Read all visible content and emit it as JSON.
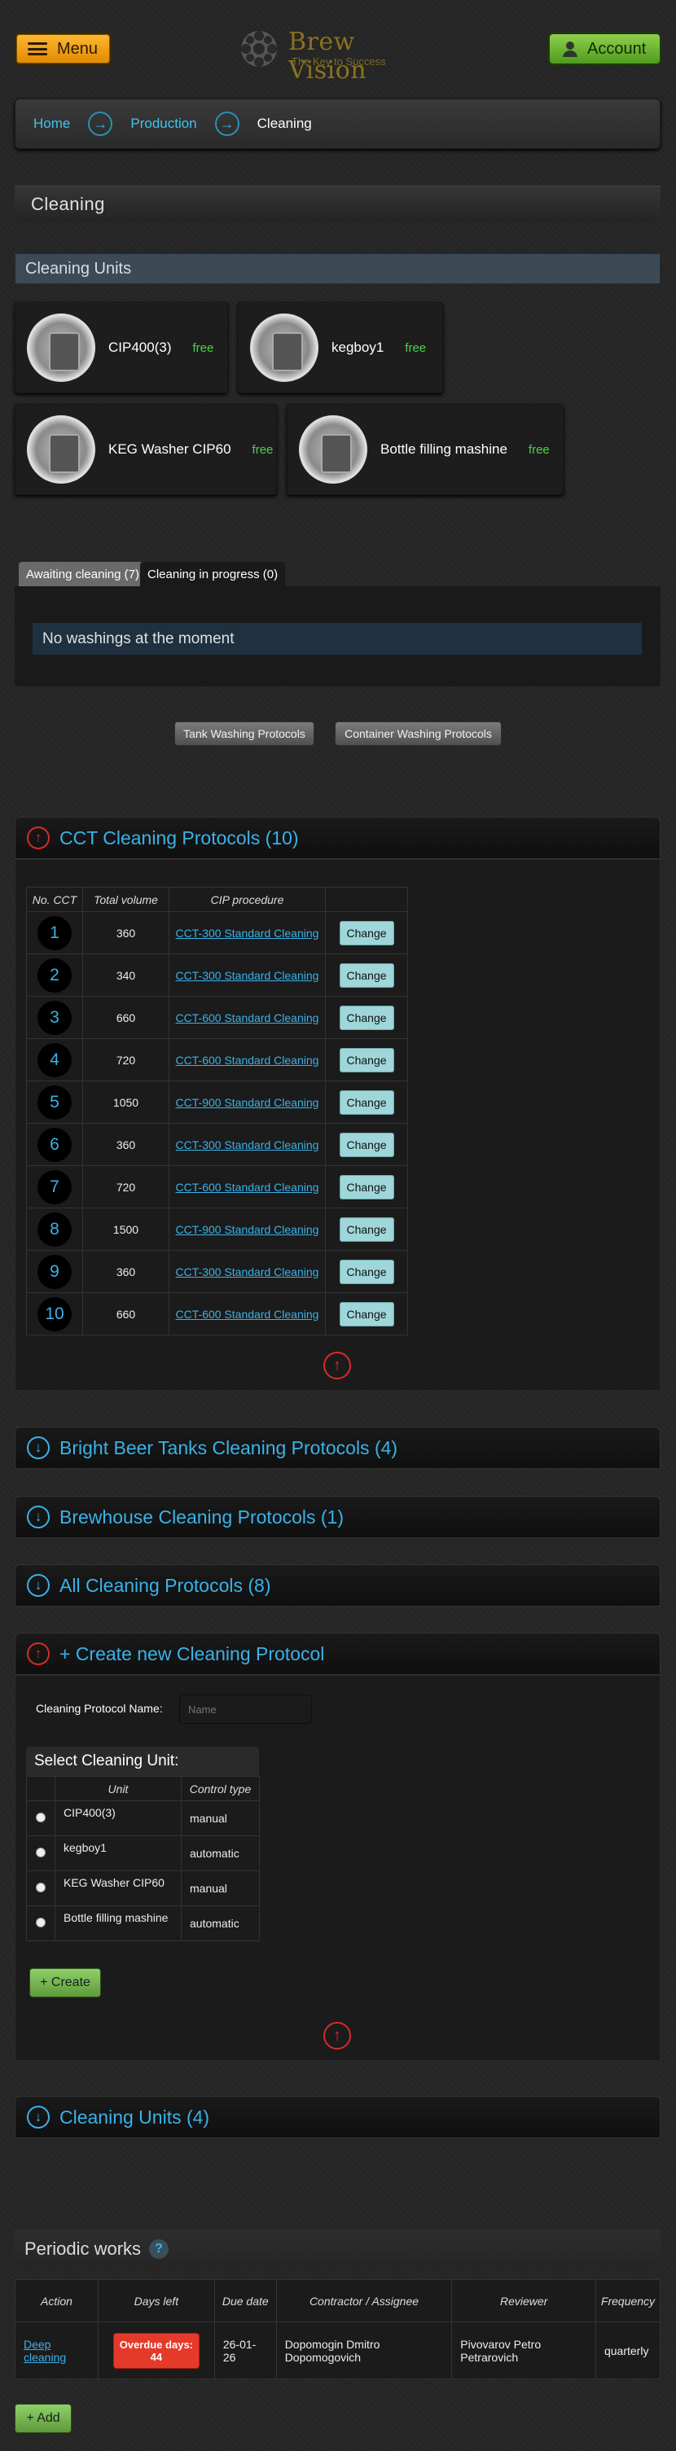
{
  "header": {
    "menu_label": "Menu",
    "logo_title": "Brew Vision",
    "logo_subtitle": "The Key to Success",
    "account_label": "Account"
  },
  "breadcrumb": {
    "items": [
      "Home",
      "Production"
    ],
    "current": "Cleaning"
  },
  "page_title": "Cleaning",
  "cleaning_units": {
    "heading": "Cleaning Units",
    "items": [
      {
        "name": "CIP400(3)",
        "status": "free"
      },
      {
        "name": "kegboy1",
        "status": "free"
      },
      {
        "name": "KEG Washer CIP60",
        "status": "free"
      },
      {
        "name": "Bottle filling mashine",
        "status": "free"
      }
    ]
  },
  "tabs": [
    {
      "label": "Awaiting cleaning (7)",
      "active": true
    },
    {
      "label": "Cleaning in progress (0)",
      "active": false
    }
  ],
  "no_washings": "No washings at the moment",
  "protocol_buttons": {
    "tank": "Tank Washing Protocols",
    "container": "Container Washing Protocols"
  },
  "cct": {
    "title": "CCT Cleaning Protocols (10)",
    "columns": [
      "No. CCT",
      "Total volume",
      "CIP procedure",
      ""
    ],
    "change_label": "Change",
    "rows": [
      {
        "no": "1",
        "volume": "360",
        "procedure": "CCT-300 Standard Cleaning"
      },
      {
        "no": "2",
        "volume": "340",
        "procedure": "CCT-300 Standard Cleaning"
      },
      {
        "no": "3",
        "volume": "660",
        "procedure": "CCT-600 Standard Cleaning"
      },
      {
        "no": "4",
        "volume": "720",
        "procedure": "CCT-600 Standard Cleaning"
      },
      {
        "no": "5",
        "volume": "1050",
        "procedure": "CCT-900 Standard Cleaning"
      },
      {
        "no": "6",
        "volume": "360",
        "procedure": "CCT-300 Standard Cleaning"
      },
      {
        "no": "7",
        "volume": "720",
        "procedure": "CCT-600 Standard Cleaning"
      },
      {
        "no": "8",
        "volume": "1500",
        "procedure": "CCT-900 Standard Cleaning"
      },
      {
        "no": "9",
        "volume": "360",
        "procedure": "CCT-300 Standard Cleaning"
      },
      {
        "no": "10",
        "volume": "660",
        "procedure": "CCT-600 Standard Cleaning"
      }
    ]
  },
  "sections": {
    "bright_beer": "Bright Beer Tanks Cleaning Protocols (4)",
    "brewhouse": "Brewhouse Cleaning Protocols (1)",
    "all": "All Cleaning Protocols (8)",
    "create": "+ Create new Cleaning Protocol",
    "cleaning_units": "Cleaning Units (4)"
  },
  "create_form": {
    "name_label": "Cleaning Protocol Name:",
    "name_placeholder": "Name",
    "select_heading": "Select Cleaning Unit:",
    "columns": [
      "Unit",
      "Control type"
    ],
    "units": [
      {
        "unit": "CIP400(3)",
        "control": "manual"
      },
      {
        "unit": "kegboy1",
        "control": "automatic"
      },
      {
        "unit": "KEG Washer CIP60",
        "control": "manual"
      },
      {
        "unit": "Bottle filling mashine",
        "control": "automatic"
      }
    ],
    "create_label": "+ Create"
  },
  "periodic": {
    "heading": "Periodic works",
    "help": "?",
    "columns": [
      "Action",
      "Days left",
      "Due date",
      "Contractor / Assignee",
      "Reviewer",
      "Frequency"
    ],
    "rows": [
      {
        "action": "Deep cleaning",
        "overdue_label": "Overdue days:",
        "overdue_days": "44",
        "due": "26-01-26",
        "contractor": "Dopomogin Dmitro Dopomogovich",
        "reviewer": "Pivovarov Petro Petrarovich",
        "frequency": "quarterly"
      }
    ],
    "add_label": "+ Add"
  },
  "colors": {
    "accent_blue": "#3ab2e8",
    "free_green": "#4cd24c",
    "menu_orange": "#ffb733",
    "account_green": "#8fd04a",
    "overdue_red": "#e53a2a",
    "collapse_red": "#d92a2a"
  },
  "icons": {
    "menu": "hamburger-icon",
    "account": "user-icon",
    "breadcrumb_sep": "arrow-right-circle-icon",
    "expanded": "arrow-up-circle-icon",
    "collapsed": "arrow-down-circle-icon"
  }
}
